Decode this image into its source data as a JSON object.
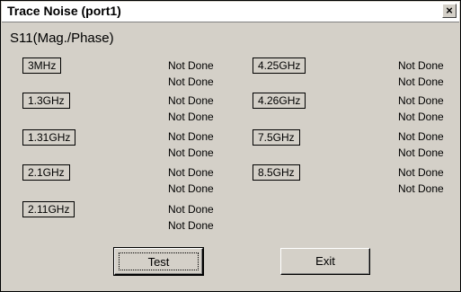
{
  "window": {
    "title": "Trace Noise (port1)",
    "close_glyph": "×"
  },
  "subtitle": "S11(Mag./Phase)",
  "left_column": [
    {
      "freq": "3MHz",
      "status": [
        "Not Done",
        "Not Done"
      ]
    },
    {
      "freq": "1.3GHz",
      "status": [
        "Not Done",
        "Not Done"
      ]
    },
    {
      "freq": "1.31GHz",
      "status": [
        "Not Done",
        "Not Done"
      ]
    },
    {
      "freq": "2.1GHz",
      "status": [
        "Not Done",
        "Not Done"
      ]
    },
    {
      "freq": "2.11GHz",
      "status": [
        "Not Done",
        "Not Done"
      ]
    }
  ],
  "right_column": [
    {
      "freq": "4.25GHz",
      "status": [
        "Not Done",
        "Not Done"
      ]
    },
    {
      "freq": "4.26GHz",
      "status": [
        "Not Done",
        "Not Done"
      ]
    },
    {
      "freq": "7.5GHz",
      "status": [
        "Not Done",
        "Not Done"
      ]
    },
    {
      "freq": "8.5GHz",
      "status": [
        "Not Done",
        "Not Done"
      ]
    }
  ],
  "buttons": {
    "test": "Test",
    "exit": "Exit"
  }
}
